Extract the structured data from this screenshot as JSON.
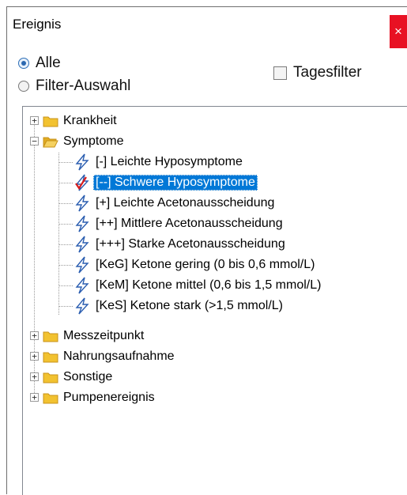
{
  "window": {
    "title": "Ereignis",
    "close_label": "×"
  },
  "filter": {
    "all_label": "Alle",
    "selection_label": "Filter-Auswahl",
    "day_filter_label": "Tagesfilter",
    "all_selected": true,
    "day_filter_checked": false
  },
  "tree": {
    "colors": {
      "selection": "#0078d7",
      "folder": "#f2c230",
      "bolt": "#2a5db0",
      "check": "#d91c1c"
    },
    "krankheit": "Krankheit",
    "symptome": "Symptome",
    "children": [
      "[-] Leichte Hyposymptome",
      "[--] Schwere Hyposymptome",
      "[+] Leichte Acetonausscheidung",
      "[++] Mittlere Acetonausscheidung",
      "[+++] Starke Acetonausscheidung",
      "[KeG] Ketone gering (0 bis 0,6 mmol/L)",
      "[KeM] Ketone mittel (0,6 bis 1,5 mmol/L)",
      "[KeS] Ketone stark (>1,5 mmol/L)"
    ],
    "messzeitpunkt": "Messzeitpunkt",
    "nahrungsaufnahme": "Nahrungsaufnahme",
    "sonstige": "Sonstige",
    "pumpenereignis": "Pumpenereignis",
    "collapsed_symbol": "+",
    "expanded_symbol": "−"
  }
}
